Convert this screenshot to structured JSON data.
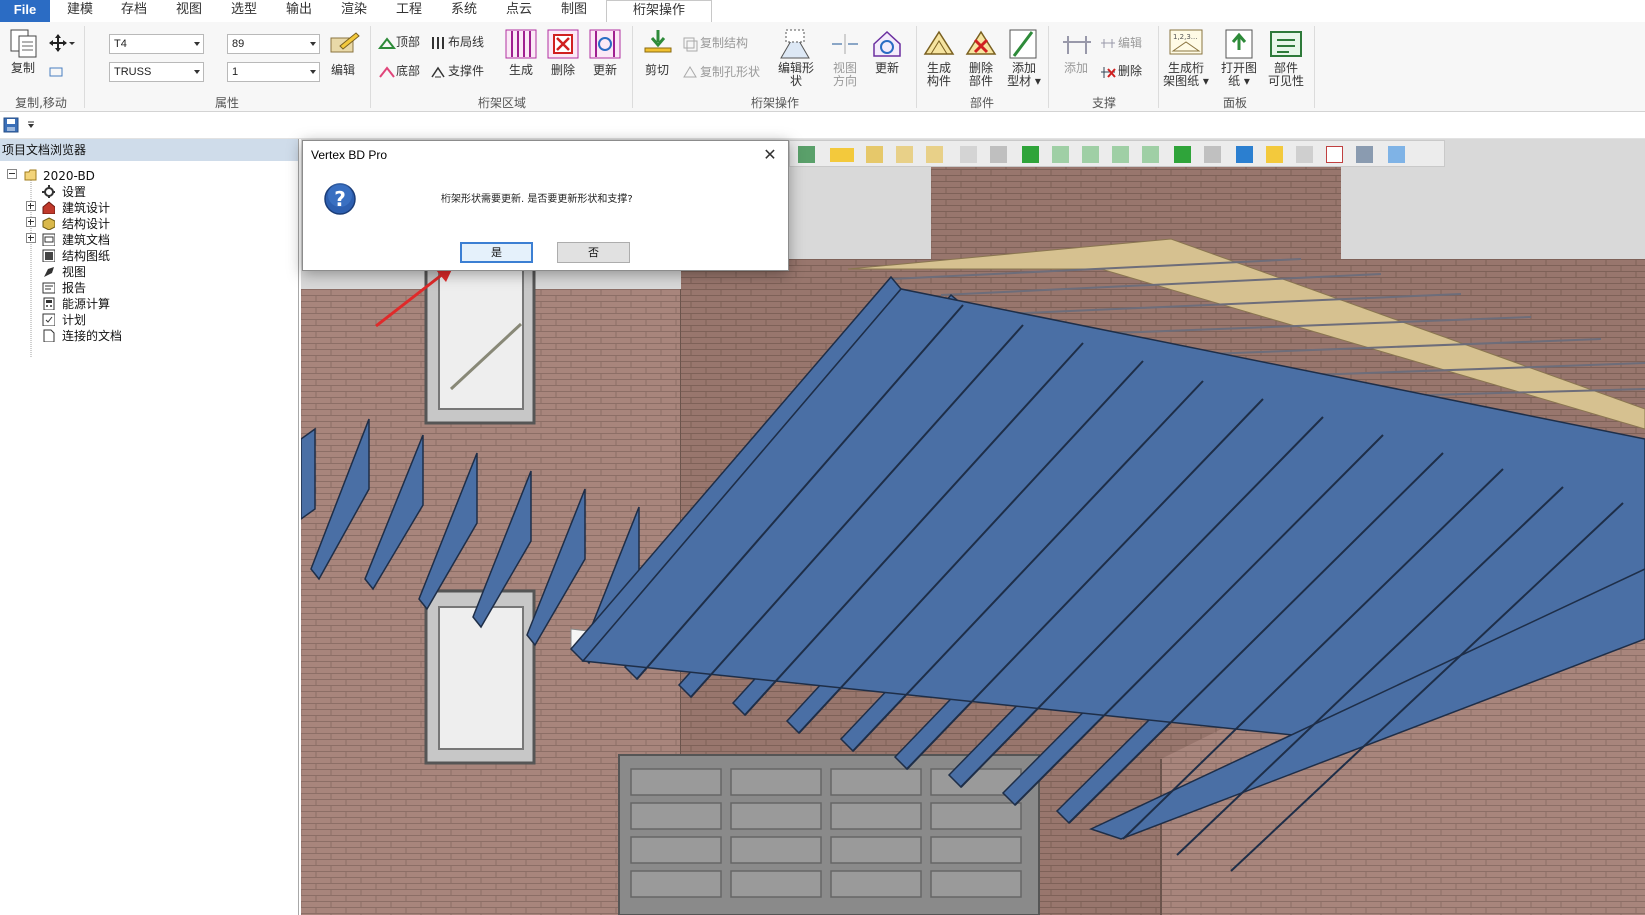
{
  "tabs": [
    {
      "label": "File"
    },
    {
      "label": "建模"
    },
    {
      "label": "存档"
    },
    {
      "label": "视图"
    },
    {
      "label": "选型"
    },
    {
      "label": "输出"
    },
    {
      "label": "渲染"
    },
    {
      "label": "工程"
    },
    {
      "label": "系统"
    },
    {
      "label": "点云"
    },
    {
      "label": "制图"
    },
    {
      "label": "桁架操作"
    }
  ],
  "ribbon": {
    "copy_move": {
      "copy_label": "复制",
      "group_label": "复制,移动"
    },
    "properties": {
      "type_value": "T4",
      "size_value": "89",
      "truss_value": "TRUSS",
      "count_value": "1",
      "edit_label": "编辑",
      "group_label": "属性"
    },
    "truss_area": {
      "top_label": "顶部",
      "bottom_label": "底部",
      "layout_line_label": "布局线",
      "brace_label": "支撑件",
      "generate_label": "生成",
      "delete_label": "删除",
      "update_label": "更新",
      "group_label": "桁架区域"
    },
    "truss_ops": {
      "cut_label": "剪切",
      "copy_structure_label": "复制结构",
      "copy_hole_label": "复制孔形状",
      "edit_shape_label_1": "编辑形",
      "edit_shape_label_2": "状",
      "view_dir_label_1": "视图",
      "view_dir_label_2": "方向",
      "update_label": "更新",
      "group_label": "桁架操作"
    },
    "parts": {
      "gen_parts_1": "生成",
      "gen_parts_2": "构件",
      "del_parts_1": "删除",
      "del_parts_2": "部件",
      "add_profile_1": "添加",
      "add_profile_2": "型材",
      "group_label": "部件"
    },
    "bracing": {
      "add_label": "添加",
      "edit_label": "编辑",
      "delete_label": "删除",
      "group_label": "支撑"
    },
    "panel": {
      "gen_drawing_1": "生成桁",
      "gen_drawing_2": "架图纸",
      "open_drawing_1": "打开图",
      "open_drawing_2": "纸",
      "visibility_1": "部件",
      "visibility_2": "可见性",
      "group_label": "面板"
    }
  },
  "browser": {
    "title": "项目文档浏览器",
    "tree": [
      {
        "label": "2020-BD"
      },
      {
        "label": "设置"
      },
      {
        "label": "建筑设计"
      },
      {
        "label": "结构设计"
      },
      {
        "label": "建筑文档"
      },
      {
        "label": "结构图纸"
      },
      {
        "label": "视图"
      },
      {
        "label": "报告"
      },
      {
        "label": "能源计算"
      },
      {
        "label": "计划"
      },
      {
        "label": "连接的文档"
      }
    ]
  },
  "dialog": {
    "title": "Vertex BD Pro",
    "message": "桁架形状需要更新. 是否要更新形状和支撑?",
    "yes_label": "是",
    "no_label": "否"
  },
  "colors": {
    "file_tab": "#2b6cc4",
    "accent_red": "#e02a2a",
    "truss_blue": "#4a6fa5",
    "brick": "#a8857c",
    "roof_board": "#d6c190"
  }
}
